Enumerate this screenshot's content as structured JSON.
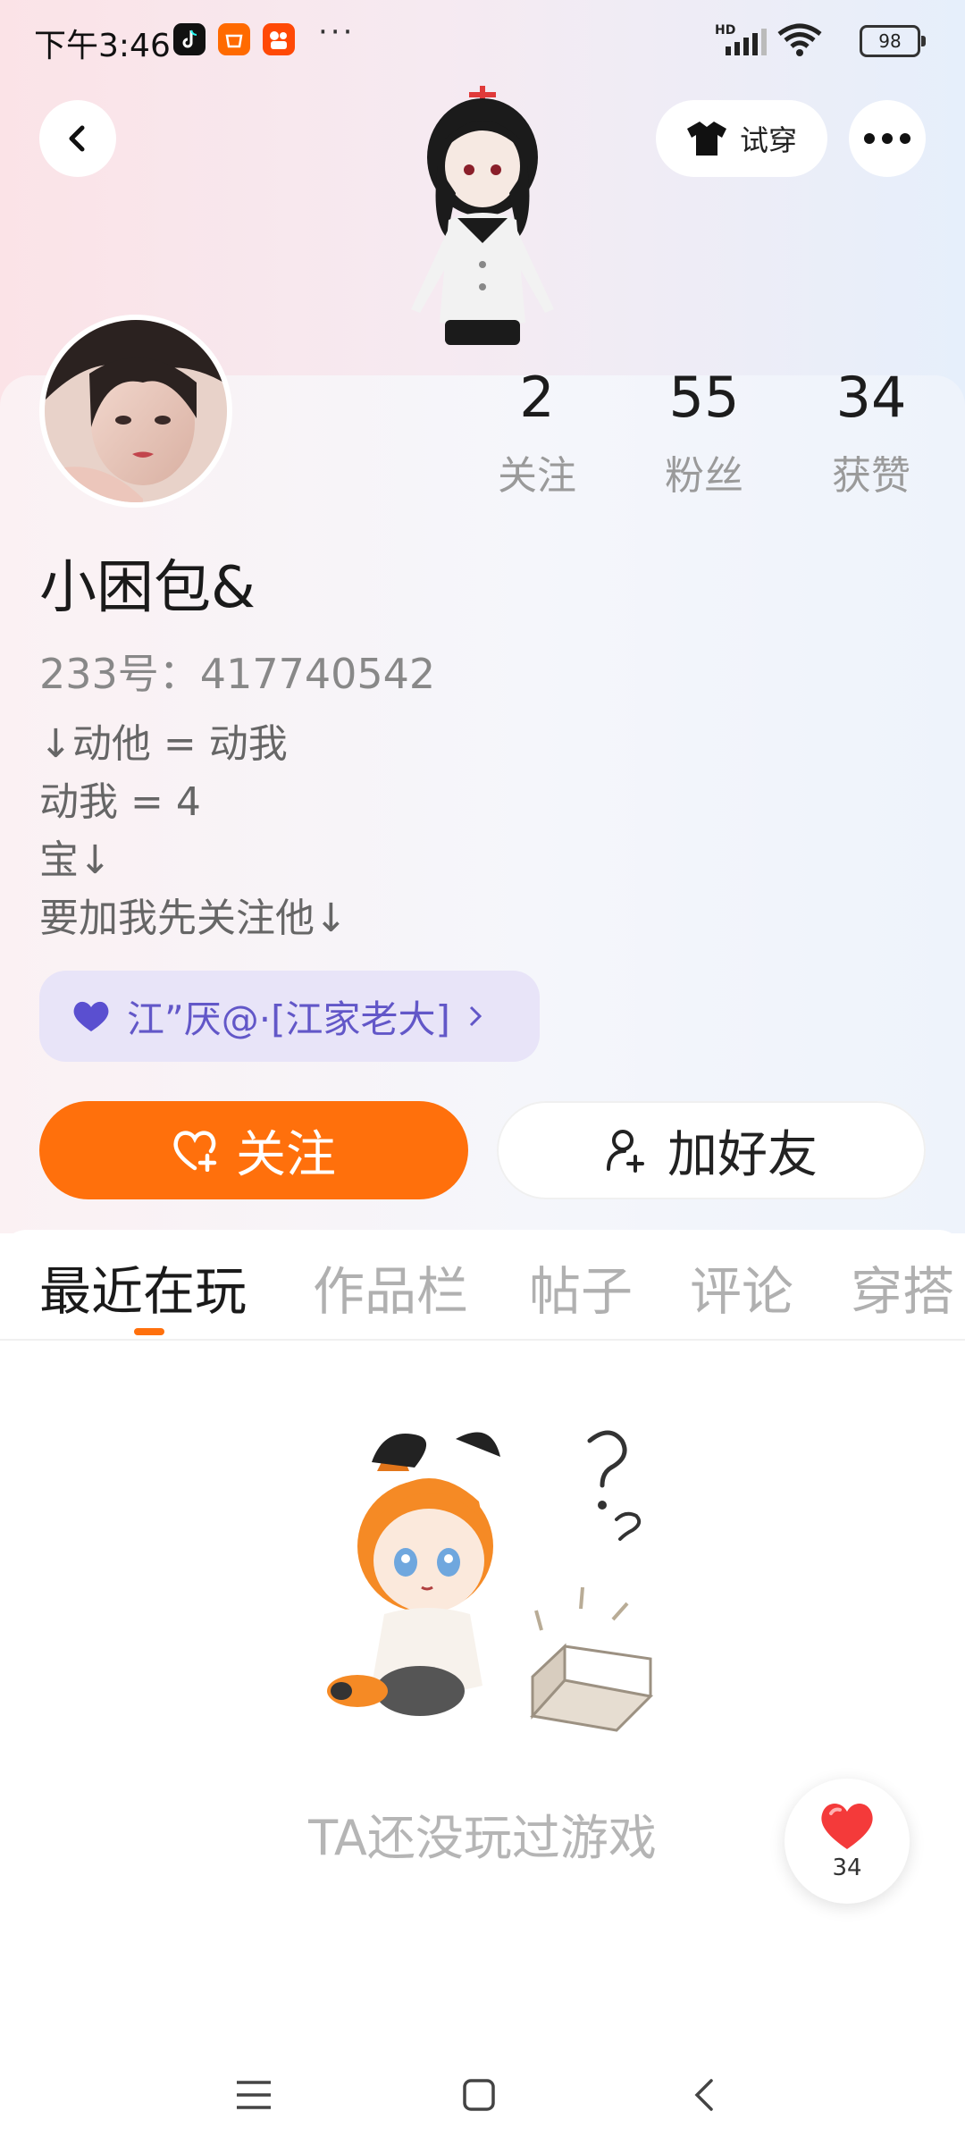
{
  "status_bar": {
    "time": "下午3:46",
    "more": "···",
    "network": "HD",
    "battery": "98"
  },
  "header": {
    "tryon_label": "试穿"
  },
  "profile": {
    "name": "小困包&",
    "uid": "233号：417740542",
    "bio": [
      "↓动他 = 动我",
      "动我 = 4",
      "宝↓",
      "要加我先关注他↓"
    ],
    "group": "江”厌@·[江家老大]"
  },
  "stats": [
    {
      "value": "2",
      "label": "关注"
    },
    {
      "value": "55",
      "label": "粉丝"
    },
    {
      "value": "34",
      "label": "获赞"
    }
  ],
  "actions": {
    "follow_label": "关注",
    "add_friend_label": "加好友"
  },
  "tabs": [
    {
      "label": "最近在玩",
      "active": true
    },
    {
      "label": "作品栏",
      "active": false
    },
    {
      "label": "帖子",
      "active": false
    },
    {
      "label": "评论",
      "active": false
    },
    {
      "label": "穿搭",
      "active": false
    }
  ],
  "empty_state": {
    "text": "TA还没玩过游戏"
  },
  "like_fab": {
    "count": "34"
  },
  "colors": {
    "accent": "#ff700c",
    "group_chip_bg": "#e8e4f8",
    "group_chip_text": "#6257c8"
  }
}
